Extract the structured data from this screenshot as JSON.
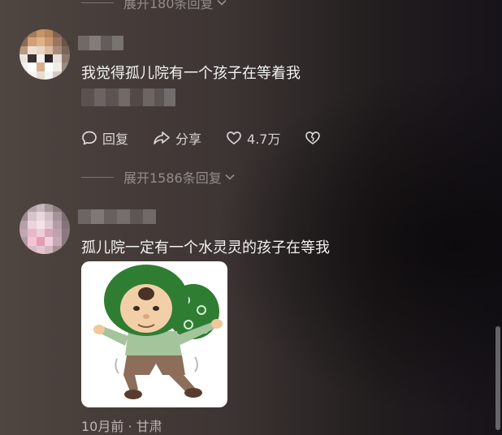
{
  "thread1": {
    "expand_label": "展开180条回复"
  },
  "comment1": {
    "text": "我觉得孤儿院有一个孩子在等着我",
    "actions": {
      "reply_label": "回复",
      "share_label": "分享",
      "like_count": "4.7万"
    },
    "expand_label": "展开1586条回复"
  },
  "comment2": {
    "text": "孤儿院一定有一个水灵灵的孩子在等我",
    "meta": "10月前 · 甘肃"
  },
  "icons": {
    "reply": "speech-bubble-icon",
    "share": "share-arrow-icon",
    "like": "heart-icon",
    "dislike": "broken-heart-icon",
    "expand": "chevron-down-icon"
  },
  "colors": {
    "text": "#f2f2f2",
    "muted": "#9c9592",
    "sticker_bg": "#ffffff",
    "sticker_hood": "#2f7d32"
  }
}
